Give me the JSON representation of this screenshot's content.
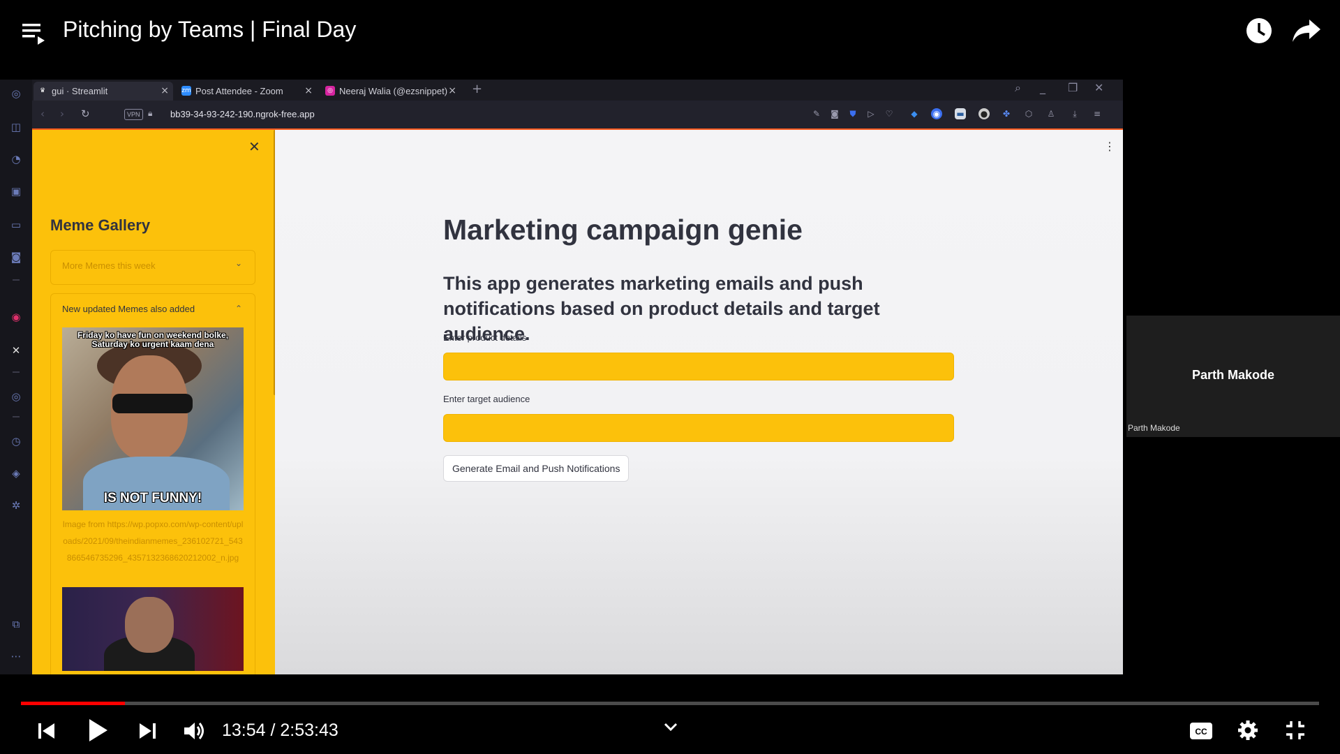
{
  "video": {
    "title": "Pitching by Teams | Final Day",
    "current_time": "13:54",
    "duration": "2:53:43",
    "time_display": "13:54 / 2:53:43",
    "progress_fraction": 0.0799
  },
  "browser": {
    "tabs": [
      {
        "title": "gui · Streamlit",
        "icon": "streamlit-icon",
        "active": true
      },
      {
        "title": "Post Attendee - Zoom",
        "icon": "zoom-icon",
        "active": false
      },
      {
        "title": "Neeraj Walia (@ezsnippet)",
        "icon": "instagram-icon",
        "active": false
      }
    ],
    "vpn_badge": "VPN",
    "url": "bb39-34-93-242-190.ngrok-free.app"
  },
  "app": {
    "sidebar": {
      "title": "Meme Gallery",
      "expanders": [
        {
          "label": "More Memes this week",
          "expanded": false
        },
        {
          "label": "New updated Memes also added",
          "expanded": true
        }
      ],
      "meme_top_text": "Friday ko have fun on weekend bolke, Saturday ko urgent kaam dena",
      "meme_bottom_text": "IS NOT FUNNY!",
      "meme_caption": "Image from https://wp.popxo.com/wp-content/uploads/2021/09/theindianmemes_236102721_543866546735296_4357132368620212002_n.jpg"
    },
    "title": "Marketing campaign genie",
    "subtitle": "This app generates marketing emails and push notifications based on product details and target audience.",
    "product_label": "Enter product details",
    "product_value": "",
    "audience_label": "Enter target audience",
    "audience_value": "",
    "button_label": "Generate Email and Push Notifications"
  },
  "zoom": {
    "participant_name": "Parth Makode",
    "participant_label": "Parth Makode"
  },
  "colors": {
    "streamlit_primary": "#fcc10b",
    "progress": "#ff0000",
    "page_bg": "#f4f4f6",
    "text": "#31333f"
  }
}
